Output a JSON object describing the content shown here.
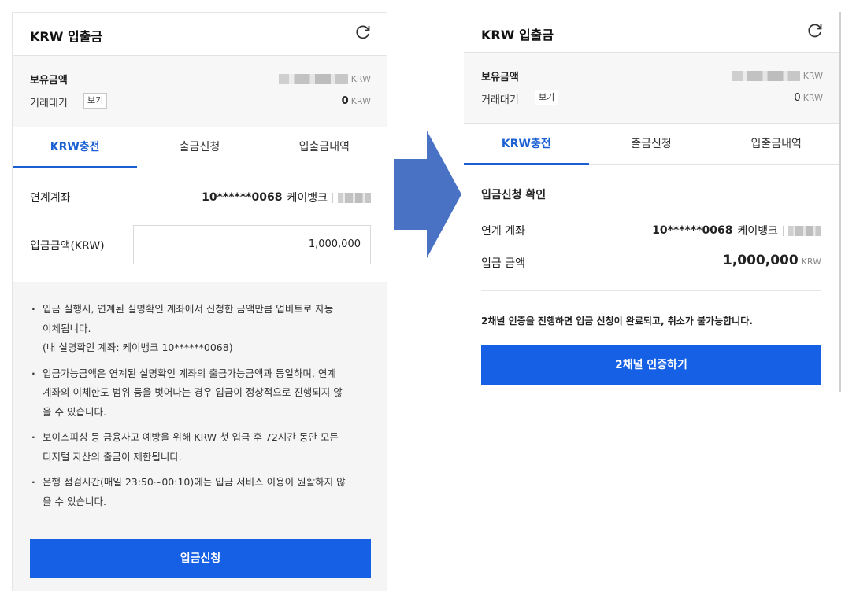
{
  "left": {
    "header": {
      "title": "KRW 입출금",
      "refresh_icon": "refresh-icon"
    },
    "balance": {
      "held_label": "보유금액",
      "held_unit": "KRW",
      "pending_label": "거래대기",
      "view_label": "보기",
      "pending_value": "0",
      "pending_unit": "KRW"
    },
    "tabs": [
      {
        "label": "KRW충전",
        "active": true
      },
      {
        "label": "출금신청",
        "active": false
      },
      {
        "label": "입출금내역",
        "active": false
      }
    ],
    "linked_account_label": "연계계좌",
    "linked_account_number": "10******0068",
    "linked_bank": "케이뱅크",
    "deposit_amount_label": "입금금액(KRW)",
    "deposit_amount_value": "1,000,000",
    "notices": [
      {
        "lines": [
          "입금 실행시, 연계된 실명확인 계좌에서 신청한 금액만큼 업비트로 자동",
          "이체됩니다.",
          "(내 실명확인 계좌: 케이뱅크 10******0068)"
        ]
      },
      {
        "lines": [
          "입금가능금액은 연계된 실명확인 계좌의 출금가능금액과 동일하며, 연계",
          "계좌의 이체한도 범위 등을 벗어나는 경우 입금이 정상적으로 진행되지 않",
          "을 수 있습니다."
        ]
      },
      {
        "lines": [
          "보이스피싱 등 금융사고 예방을 위해 KRW 첫 입금 후 72시간 동안 모든",
          "디지털 자산의 출금이 제한됩니다."
        ]
      },
      {
        "lines": [
          "은행 점검시간(매일 23:50~00:10)에는 입금 서비스 이용이 원활하지 않",
          "을 수 있습니다."
        ]
      }
    ],
    "submit_label": "입금신청"
  },
  "right": {
    "header": {
      "title": "KRW 입출금",
      "refresh_icon": "refresh-icon"
    },
    "balance": {
      "held_label": "보유금액",
      "held_unit": "KRW",
      "pending_label": "거래대기",
      "view_label": "보기",
      "pending_value": "0",
      "pending_unit": "KRW"
    },
    "tabs": [
      {
        "label": "KRW충전",
        "active": true
      },
      {
        "label": "출금신청",
        "active": false
      },
      {
        "label": "입출금내역",
        "active": false
      }
    ],
    "confirm_title": "입금신청 확인",
    "linked_account_label": "연계 계좌",
    "linked_account_number": "10******0068",
    "linked_bank": "케이뱅크",
    "deposit_amount_label": "입금 금액",
    "deposit_amount_value": "1,000,000",
    "deposit_amount_unit": "KRW",
    "auth_notice": "2채널 인증을 진행하면 입금 신청이 완료되고, 취소가 불가능합니다.",
    "auth_button_label": "2채널 인증하기"
  },
  "arrow_icon": "arrow-right-icon",
  "colors": {
    "accent": "#1660e6",
    "tab_active": "#1b5fd3",
    "arrow": "#4a72c4"
  }
}
